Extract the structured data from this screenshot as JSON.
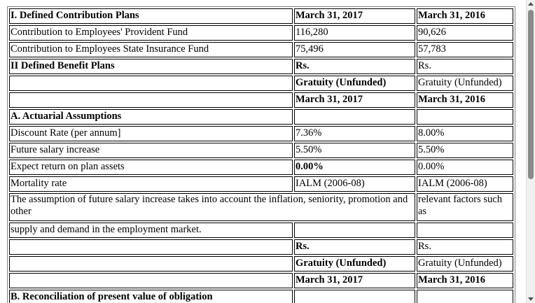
{
  "table": {
    "rows": [
      {
        "cells": [
          {
            "text": "I. Defined Contribution Plans",
            "bold": true
          },
          {
            "text": "March 31, 2017",
            "bold": true
          },
          {
            "text": "March 31, 2016",
            "bold": true
          }
        ]
      },
      {
        "cells": [
          {
            "text": "Contribution to Employees' Provident Fund"
          },
          {
            "text": "116,280"
          },
          {
            "text": "90,626"
          }
        ]
      },
      {
        "cells": [
          {
            "text": "Contribution to Employees State Insurance Fund"
          },
          {
            "text": "75,496"
          },
          {
            "text": "57,783"
          }
        ]
      },
      {
        "cells": [
          {
            "text": "II Defined Benefit Plans",
            "bold": true
          },
          {
            "text": "Rs.",
            "bold": true
          },
          {
            "text": "Rs."
          }
        ]
      },
      {
        "cells": [
          {
            "text": ""
          },
          {
            "text": "Gratuity (Unfunded)",
            "bold": true
          },
          {
            "text": "Gratuity (Unfunded)"
          }
        ]
      },
      {
        "cells": [
          {
            "text": ""
          },
          {
            "text": "March 31, 2017",
            "bold": true
          },
          {
            "text": "March 31, 2016",
            "bold": true
          }
        ]
      },
      {
        "cells": [
          {
            "text": "A. Actuarial Assumptions",
            "bold": true
          },
          {
            "text": ""
          },
          {
            "text": ""
          }
        ]
      },
      {
        "cells": [
          {
            "text": "Discount Rate (per annum]"
          },
          {
            "text": "7.36%"
          },
          {
            "text": "8.00%"
          }
        ]
      },
      {
        "cells": [
          {
            "text": "Future salary increase"
          },
          {
            "text": "5.50%"
          },
          {
            "text": "5.50%"
          }
        ]
      },
      {
        "cells": [
          {
            "text": "Expect return on plan assets"
          },
          {
            "text": "0.00%",
            "bold": true
          },
          {
            "text": "0.00%"
          }
        ]
      },
      {
        "cells": [
          {
            "text": "Mortality rate"
          },
          {
            "text": "IALM (2006-08)"
          },
          {
            "text": "IALM (2006-08)"
          }
        ]
      },
      {
        "merged": true,
        "tall": true,
        "cells": [
          {
            "text": "The assumption of future salary increase takes into account the inflation, seniority, promotion and other"
          },
          {
            "text": "relevant factors such as"
          }
        ]
      },
      {
        "cells": [
          {
            "text": "supply and demand in the employment market."
          },
          {
            "text": ""
          },
          {
            "text": ""
          }
        ]
      },
      {
        "cells": [
          {
            "text": ""
          },
          {
            "text": "Rs.",
            "bold": true
          },
          {
            "text": "Rs."
          }
        ]
      },
      {
        "cells": [
          {
            "text": ""
          },
          {
            "text": "Gratuity (Unfunded)",
            "bold": true
          },
          {
            "text": "Gratuity (Unfunded)"
          }
        ]
      },
      {
        "cells": [
          {
            "text": ""
          },
          {
            "text": "March 31, 2017",
            "bold": true
          },
          {
            "text": "March 31, 2016",
            "bold": true
          }
        ]
      },
      {
        "cells": [
          {
            "text": "B. Reconciliation of present value of obligation",
            "bold": true
          },
          {
            "text": ""
          },
          {
            "text": ""
          }
        ]
      }
    ]
  },
  "scrollbar": {
    "position_fraction": 0.0
  }
}
